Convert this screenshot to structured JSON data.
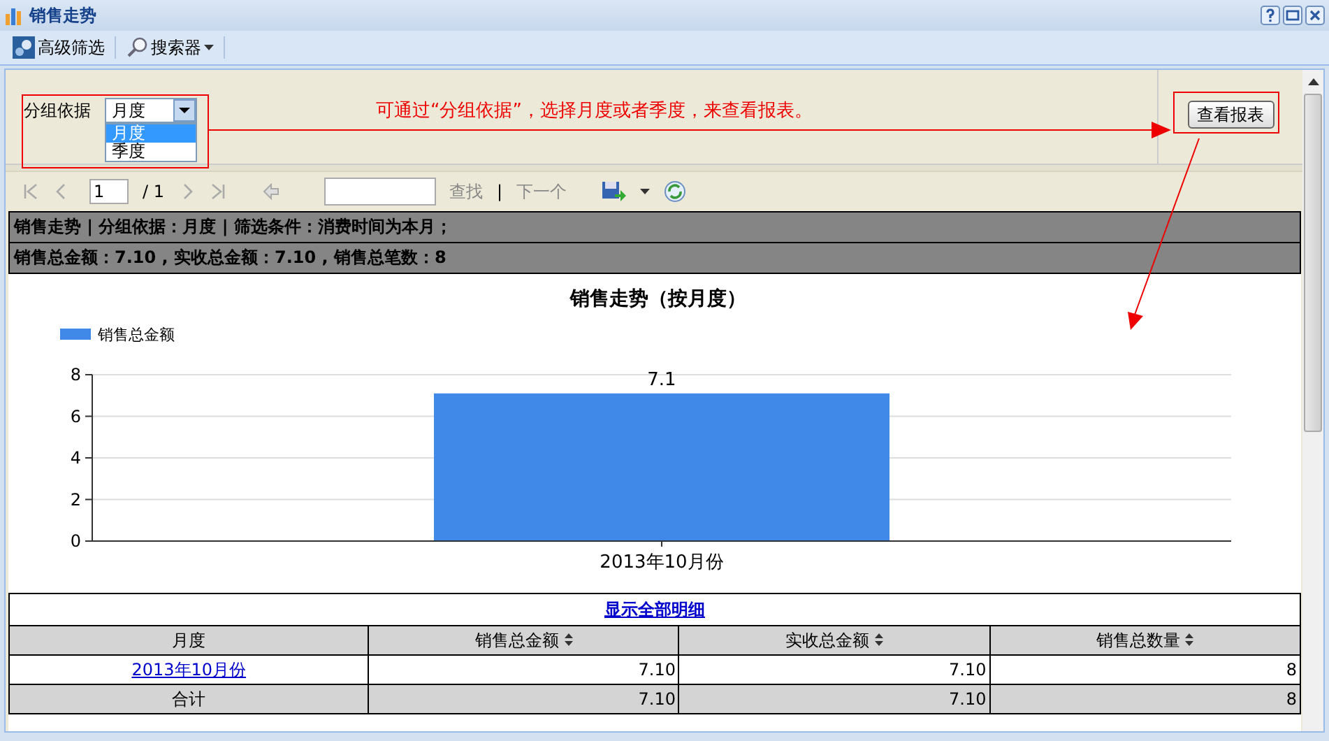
{
  "window": {
    "title": "销售走势"
  },
  "toolbar": [
    {
      "label": "高级筛选",
      "kind": "button"
    },
    {
      "label": "搜索器",
      "kind": "menu"
    }
  ],
  "filter": {
    "label": "分组依据",
    "value": "月度",
    "expanded": true,
    "options": [
      {
        "label": "月度",
        "selected": true
      },
      {
        "label": "季度",
        "selected": false
      }
    ],
    "hint": "可通过“分组依据”，选择月度或者季度，来查看报表。",
    "button": "查看报表"
  },
  "pager": {
    "page": "1",
    "total": "/ 1",
    "find": "查找",
    "separator": "|",
    "next": "下一个"
  },
  "report": {
    "header": "销售走势 | 分组依据：月度 | 筛选条件：消费时间为本月；",
    "summary": "销售总金额：7.10 , 实收总金额：7.10 , 销售总笔数：8",
    "chart_data": {
      "type": "bar",
      "title": "销售走势（按月度）",
      "categories": [
        "2013年10月份"
      ],
      "series": [
        {
          "name": "销售总金额",
          "color": "#4189e8",
          "values": [
            7.1
          ]
        }
      ],
      "ylim": [
        0,
        8
      ],
      "yticks": [
        0,
        2,
        4,
        6,
        8
      ],
      "grid": true,
      "data_labels": true
    },
    "detail_link": "显示全部明细",
    "table": {
      "columns": [
        {
          "label": "月度",
          "sortable": false
        },
        {
          "label": "销售总金额",
          "sortable": true
        },
        {
          "label": "实收总金额",
          "sortable": true
        },
        {
          "label": "销售总数量",
          "sortable": true
        }
      ],
      "rows": [
        {
          "kind": "data",
          "cells": [
            "2013年10月份",
            "7.10",
            "7.10",
            "8"
          ]
        },
        {
          "kind": "total",
          "cells": [
            "合计",
            "7.10",
            "7.10",
            "8"
          ]
        }
      ]
    }
  }
}
